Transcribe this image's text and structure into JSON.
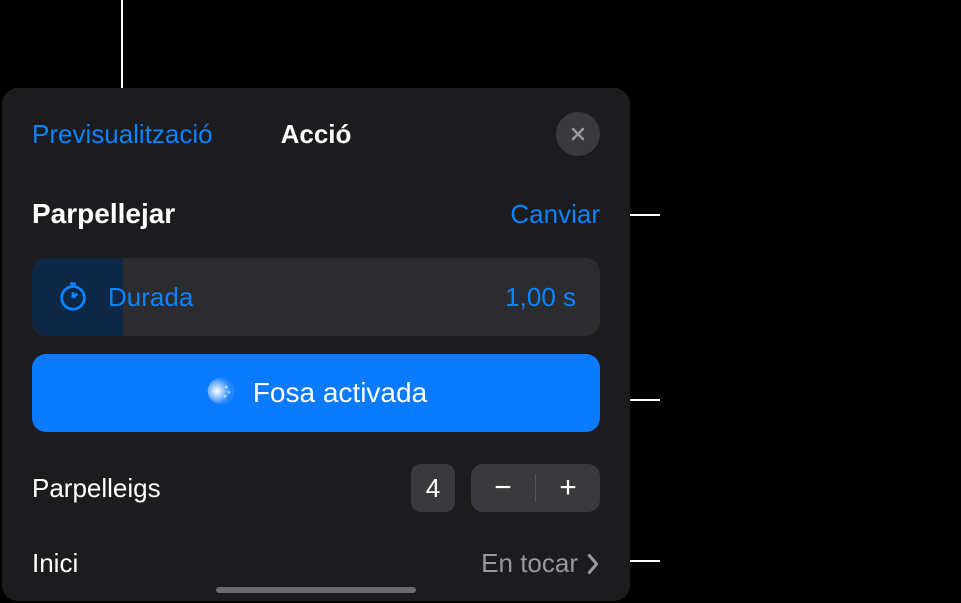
{
  "header": {
    "preview": "Previsualització",
    "title": "Acció"
  },
  "effect": {
    "name": "Parpellejar",
    "change_label": "Canviar"
  },
  "duration": {
    "label": "Durada",
    "value": "1,00 s"
  },
  "blurfade": {
    "label": "Fosa activada"
  },
  "blinks": {
    "label": "Parpelleigs",
    "value": "4"
  },
  "start": {
    "label": "Inici",
    "value": "En tocar"
  }
}
